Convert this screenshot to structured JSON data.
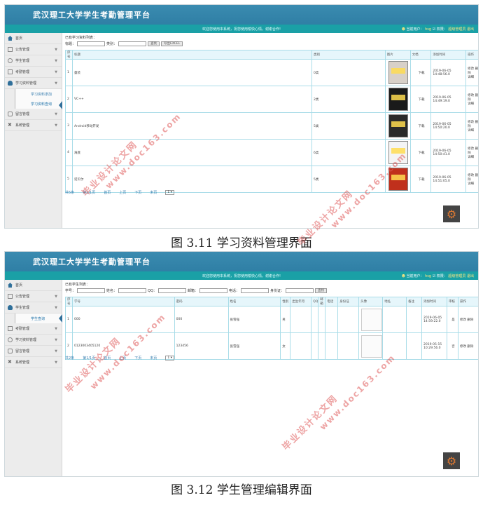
{
  "app_title": "武汉理工大学学生考勤管理平台",
  "welcome_text": "欢迎您使用本系统，祝您使用愉快心情，谢谢合作!",
  "user_bar": {
    "prefix": "当前用户：",
    "user": "hsg",
    "role_prefix": "权限：",
    "role": "超级管理员",
    "logout": "退出"
  },
  "sidebar": {
    "home": "首页",
    "notice": "公告管理",
    "student": "学生管理",
    "attendance": "考勤管理",
    "material": "学习资料管理",
    "message": "留言管理",
    "system": "系统管理",
    "material_add": "学习资料添加",
    "material_query": "学习资料查询",
    "student_query": "学生查询"
  },
  "screen1": {
    "breadcrumb": "已有学习资料列表：",
    "search": {
      "title_label": "标题：",
      "type_label": "类别：",
      "search_btn": "查找",
      "export_btn": "导出EXCEL"
    },
    "columns": [
      "序号",
      "标题",
      "类别",
      "图片",
      "文档",
      "添加时间",
      "操作"
    ],
    "rows": [
      {
        "no": "1",
        "title": "童装",
        "type": "0类",
        "doc": "下载",
        "time": "2019-06-05 14:48:56.0",
        "op1": "修改",
        "op2": "删除",
        "op3": "详细",
        "cover": "#d8d0c8"
      },
      {
        "no": "2",
        "title": "VC++",
        "type": "2类",
        "doc": "下载",
        "time": "2019-06-05 14:49:19.0",
        "op1": "修改",
        "op2": "删除",
        "op3": "详细",
        "cover": "#1a1a1a"
      },
      {
        "no": "3",
        "title": "Android移动开发",
        "type": "5类",
        "doc": "下载",
        "time": "2019-06-05 14:50:20.0",
        "op1": "修改",
        "op2": "删除",
        "op3": "详细",
        "cover": "#2a2a2a"
      },
      {
        "no": "4",
        "title": "海底",
        "type": "6类",
        "doc": "下载",
        "time": "2019-06-05 14:50:41.0",
        "op1": "修改",
        "op2": "删除",
        "op3": "详细",
        "cover": "#f4f4f4"
      },
      {
        "no": "5",
        "title": "诺贝尔",
        "type": "5类",
        "doc": "下载",
        "time": "2019-06-05 14:51:05.0",
        "op1": "修改",
        "op2": "删除",
        "op3": "详细",
        "cover": "#c0301c"
      }
    ],
    "pager": {
      "total": "共5条",
      "pages": "第1/1页",
      "first": "首页",
      "prev": "上页",
      "next": "下页",
      "last": "末页",
      "select": "1 ▾"
    }
  },
  "screen2": {
    "breadcrumb": "已有学生列表：",
    "search": {
      "no_label": "学号：",
      "name_label": "姓名：",
      "qq_label": "QQ：",
      "email_label": "邮箱：",
      "phone_label": "电话：",
      "id_label": "身份证：",
      "search_btn": "查找"
    },
    "columns": [
      "序号",
      "学号",
      "密码",
      "姓名",
      "性别",
      "出生年月",
      "QQ",
      "邮箱",
      "电话",
      "身份证",
      "头像",
      "地址",
      "备注",
      "添加时间",
      "审核",
      "操作"
    ],
    "rows": [
      {
        "no": "1",
        "sno": "000",
        "pwd": "000",
        "name": "张雪强",
        "sex": "男",
        "time": "2019-06-05 14:59:22.0",
        "audit": "是",
        "op1": "修改",
        "op2": "删除"
      },
      {
        "no": "2",
        "sno": "0123003405120",
        "pwd": "123456",
        "name": "张雪强",
        "sex": "女",
        "time": "2019-05-15 10:29:56.0",
        "audit": "否",
        "op1": "修改",
        "op2": "删除"
      }
    ],
    "pager": {
      "total": "共2条",
      "pages": "第1/1页",
      "first": "首页",
      "prev": "上页",
      "next": "下页",
      "last": "末页",
      "select": "1 ▾"
    }
  },
  "captions": {
    "fig1": "图 3.11 学习资料管理界面",
    "fig2": "图 3.12 学生管理编辑界面"
  },
  "watermark": {
    "cn": "毕业设计论文网",
    "url": "www.doc163.com"
  },
  "colors": {
    "header": "#3a8bb0",
    "subbar": "#1aa0a6",
    "table_border": "#a9dce8",
    "watermark": "#e05a5a"
  }
}
